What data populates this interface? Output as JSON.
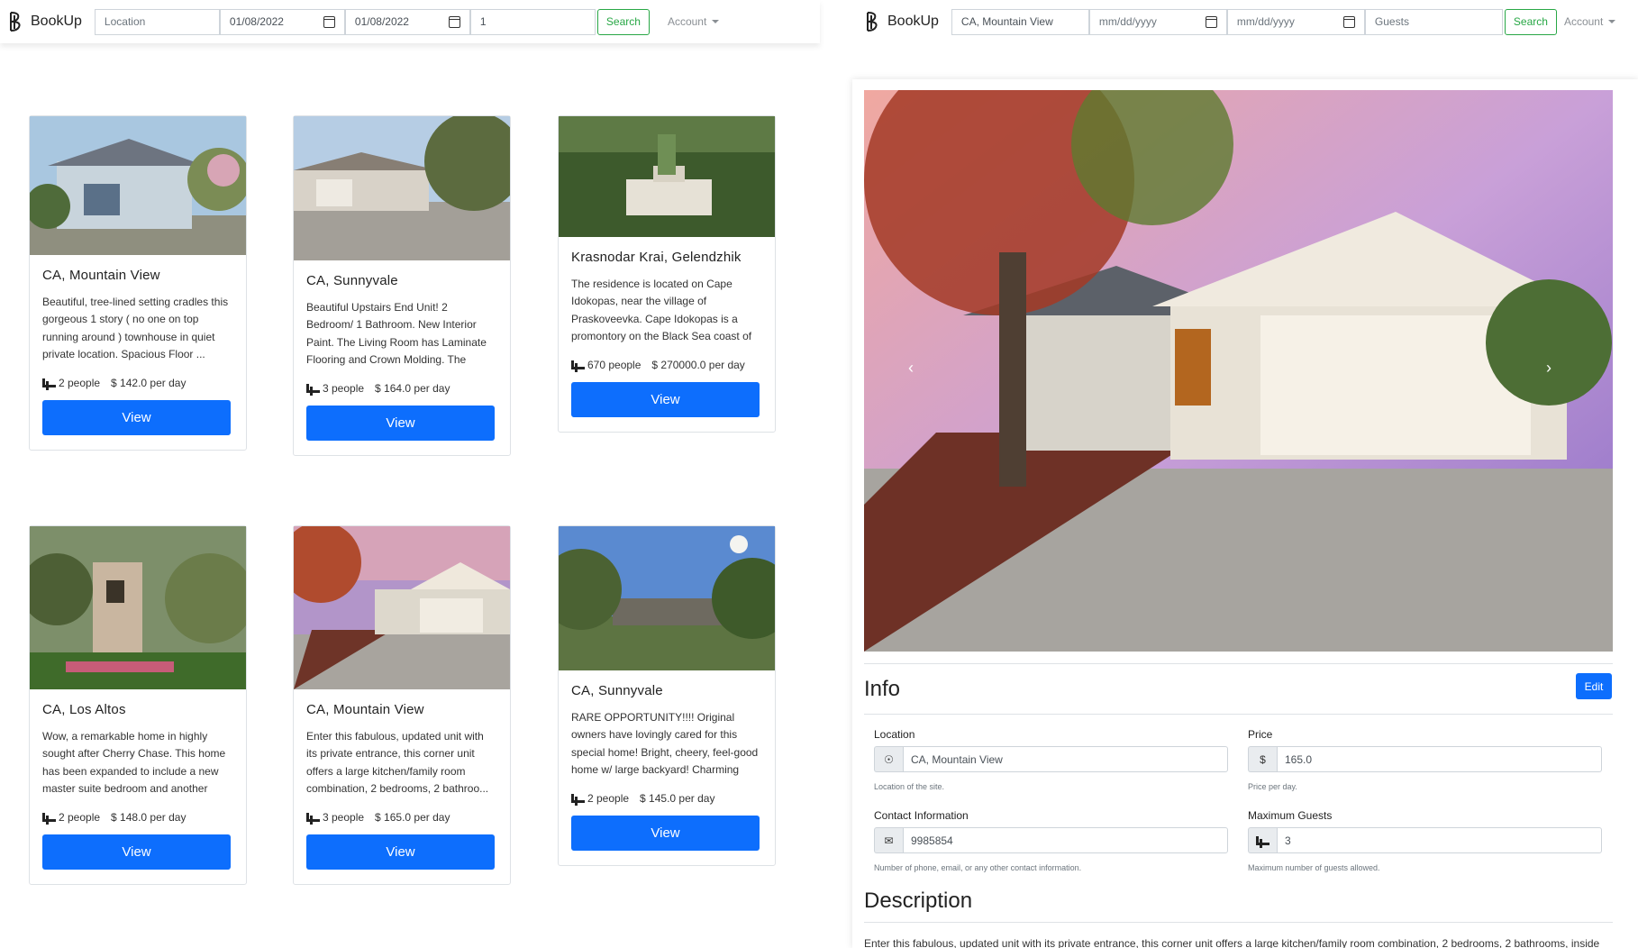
{
  "left_nav": {
    "brand": "BookUp",
    "location_placeholder": "Location",
    "check_in": "01/08/2022",
    "check_out": "01/08/2022",
    "guests": "1",
    "search_label": "Search",
    "account_label": "Account"
  },
  "right_nav": {
    "brand": "BookUp",
    "location": "CA, Mountain View",
    "check_in_placeholder": "mm/dd/yyyy",
    "check_out_placeholder": "mm/dd/yyyy",
    "guests_placeholder": "Guests",
    "search_label": "Search",
    "account_label": "Account"
  },
  "listings": [
    {
      "title": "CA, Mountain View",
      "description": "Beautiful, tree-lined setting cradles this gorgeous 1 story ( no one on top running around ) townhouse in quiet private location. Spacious Floor ...",
      "people": "2 people",
      "price": "$ 142.0 per day",
      "view_label": "View"
    },
    {
      "title": "CA, Sunnyvale",
      "description": "Beautiful Upstairs End Unit! 2 Bedroom/ 1 Bathroom. New Interior Paint. The Living Room has Laminate Flooring and Crown Molding. The Gorgeous Kitc...",
      "people": "3 people",
      "price": "$ 164.0 per day",
      "view_label": "View"
    },
    {
      "title": "Krasnodar Krai, Gelendzhik",
      "description": "The residence is located on Cape Idokopas, near the village of Praskoveevka. Cape Idokopas is a promontory on the Black Sea coast of Russia near Ge...",
      "people": "670 people",
      "price": "$ 270000.0 per day",
      "view_label": "View"
    },
    {
      "title": "CA, Los Altos",
      "description": "Wow, a remarkable home in highly sought after Cherry Chase. This home has been expanded to include a new master suite bedroom and another bedroom ...",
      "people": "2 people",
      "price": "$ 148.0 per day",
      "view_label": "View"
    },
    {
      "title": "CA, Mountain View",
      "description": "Enter this fabulous, updated unit with its private entrance, this corner unit offers a large kitchen/family room combination, 2 bedrooms, 2 bathroo...",
      "people": "3 people",
      "price": "$ 165.0 per day",
      "view_label": "View"
    },
    {
      "title": "CA, Sunnyvale",
      "description": "RARE OPPORTUNITY!!!! Original owners have lovingly cared for this special home! Bright, cheery, feel-good home w/ large backyard! Charming fire...",
      "people": "2 people",
      "price": "$ 145.0 per day",
      "view_label": "View"
    }
  ],
  "detail": {
    "info_heading": "Info",
    "edit_label": "Edit",
    "location_label": "Location",
    "location_value": "CA, Mountain View",
    "location_help": "Location of the site.",
    "price_label": "Price",
    "price_prefix": "$",
    "price_value": "165.0",
    "price_help": "Price per day.",
    "contact_label": "Contact Information",
    "contact_value": "9985854",
    "contact_help": "Number of phone, email, or any other contact information.",
    "guests_label": "Maximum Guests",
    "guests_value": "3",
    "guests_help": "Maximum number of guests allowed.",
    "description_heading": "Description",
    "description_text": "Enter this fabulous, updated unit with its private entrance, this corner unit offers a large kitchen/family room combination, 2 bedrooms, 2 bathrooms, inside"
  },
  "colors": {
    "primary": "#0d6efd",
    "success": "#28a745"
  }
}
